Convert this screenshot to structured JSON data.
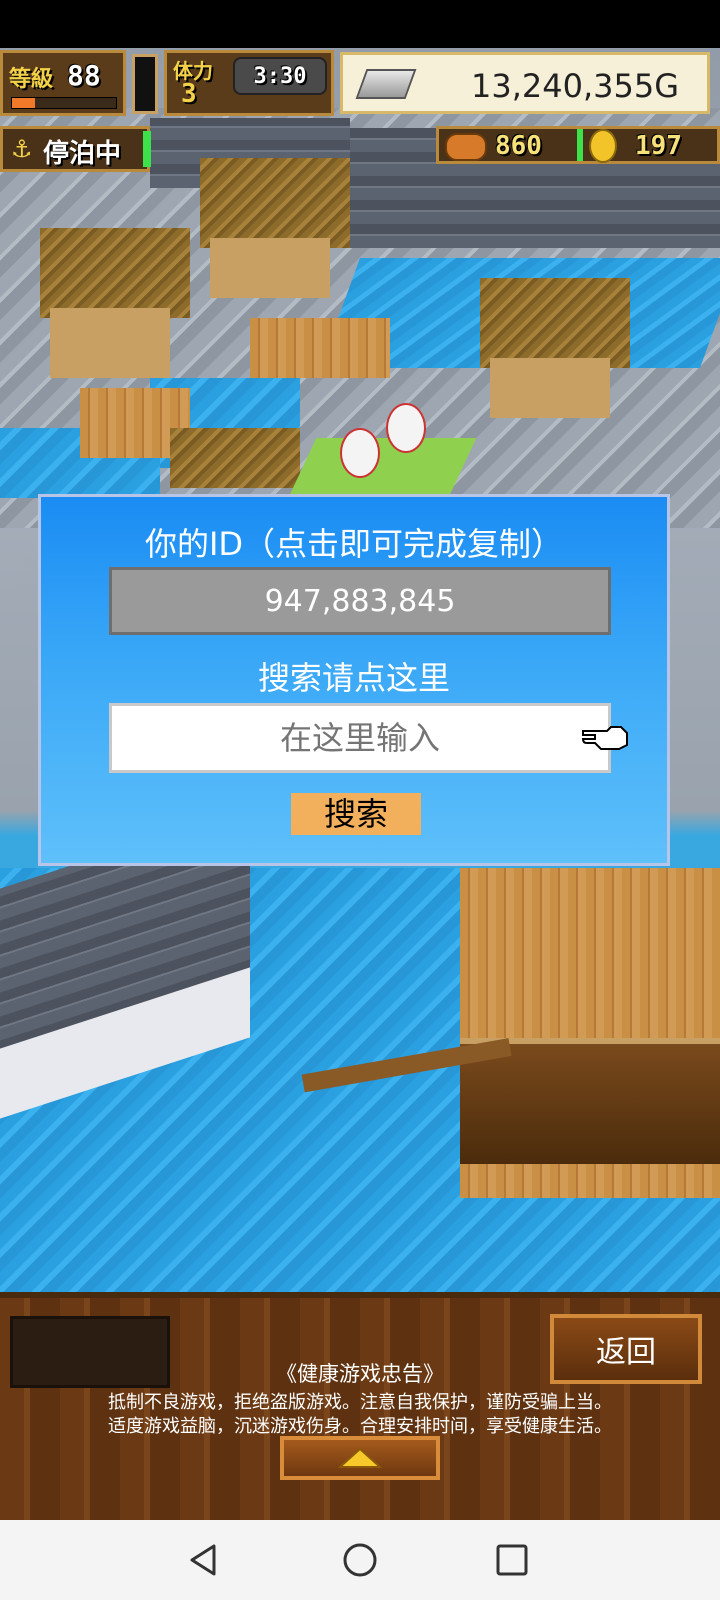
{
  "hud": {
    "level_label": "等級",
    "level": "88",
    "stamina_label": "体力",
    "stamina": "3",
    "timer": "3:30",
    "gold": "13,240,355G",
    "status": "停泊中",
    "food": "860",
    "coins": "197"
  },
  "dialog": {
    "title": "你的ID（点击即可完成复制）",
    "id_value": "947,883,845",
    "search_label": "搜索请点这里",
    "search_placeholder": "在这里输入",
    "search_button": "搜索"
  },
  "bottom": {
    "back_button": "返回",
    "notice_title": "《健康游戏忠告》",
    "notice_line1": "抵制不良游戏，拒绝盗版游戏。注意自我保护，谨防受骗上当。",
    "notice_line2": "适度游戏益脑，沉迷游戏伤身。合理安排时间，享受健康生活。"
  },
  "icons": {
    "pointer": "pointing-hand-icon",
    "back": "triangle-back-icon",
    "home": "circle-home-icon",
    "recents": "square-recents-icon"
  },
  "colors": {
    "dialog_top": "#1a8cf4",
    "dialog_bottom": "#5fc0fa",
    "search_button": "#f2b05c"
  }
}
